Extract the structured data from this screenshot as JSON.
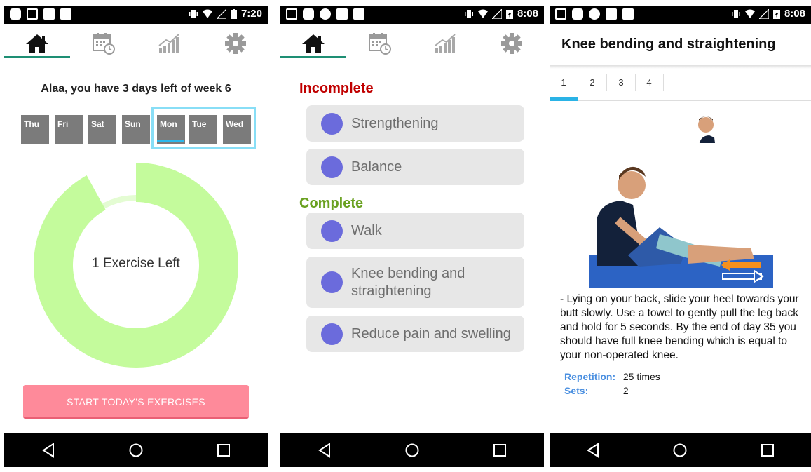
{
  "phone1": {
    "status_time": "7:20",
    "greeting": "Alaa, you have 3 days left of week 6",
    "days": [
      "Thu",
      "Fri",
      "Sat",
      "Sun",
      "Mon",
      "Tue",
      "Wed"
    ],
    "progress_label": "1 Exercise Left",
    "progress_fraction": 0.92,
    "start_button": "START TODAY'S EXERCISES"
  },
  "phone2": {
    "status_time": "8:08",
    "incomplete_label": "Incomplete",
    "complete_label": "Complete",
    "incomplete": [
      "Strengthening",
      "Balance"
    ],
    "complete": [
      "Walk",
      "Knee bending and straightening",
      "Reduce pain and swelling"
    ]
  },
  "phone3": {
    "status_time": "8:08",
    "title": "Knee bending and straightening",
    "steps": [
      "1",
      "2",
      "3",
      "4"
    ],
    "description": "- Lying on your back, slide your heel towards your butt slowly. Use a towel to gently pull the leg back and hold for 5 seconds. By the end of day 35 you should have full knee bending which is equal to your non-operated knee.",
    "repetition_label": "Repetition:",
    "repetition_value": "25 times",
    "sets_label": "Sets:",
    "sets_value": "2"
  },
  "colors": {
    "accent_green": "#1e8f74",
    "donut": "#c4fb9c",
    "button_pink": "#fe8a9a",
    "incomplete_red": "#c00000",
    "complete_green": "#6aa121",
    "dot_purple": "#6b6bdc",
    "step_blue": "#2ab3e6"
  },
  "icons": [
    "home-icon",
    "calendar-icon",
    "chart-icon",
    "gear-icon",
    "back-icon",
    "home-circle-icon",
    "recents-icon"
  ]
}
